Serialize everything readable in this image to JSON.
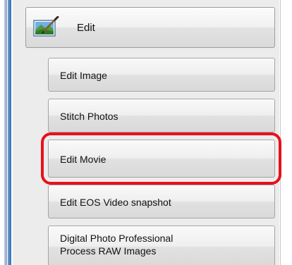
{
  "header": {
    "label": "Edit",
    "icon": "edit-picture-brush-icon"
  },
  "menu": {
    "items": [
      {
        "label": "Edit Image"
      },
      {
        "label": "Stitch Photos"
      },
      {
        "label": "Edit Movie",
        "highlighted": true
      },
      {
        "label": "Edit EOS Video snapshot"
      },
      {
        "label_line1": "Digital Photo Professional",
        "label_line2": "Process RAW Images"
      }
    ]
  },
  "colors": {
    "highlight": "#e8101c",
    "accent_bar": "#3a70b2"
  }
}
